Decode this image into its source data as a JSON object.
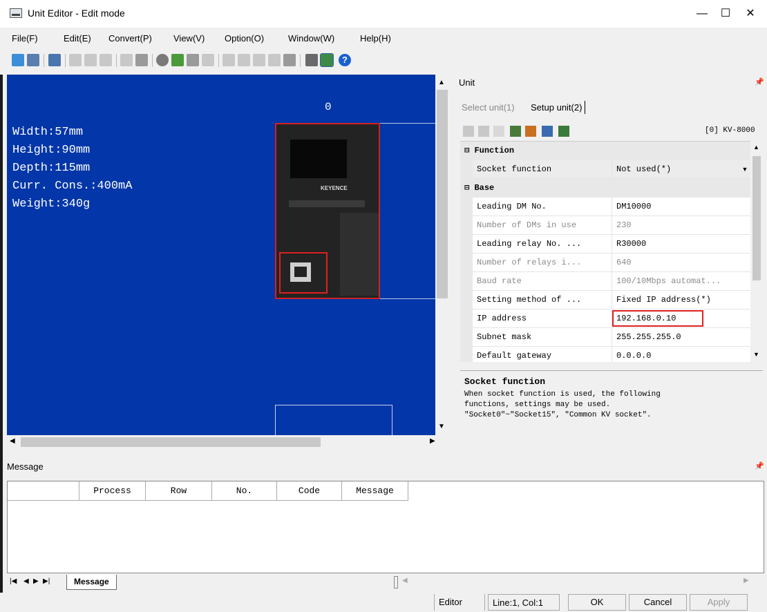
{
  "window": {
    "title": "Unit Editor - Edit mode",
    "minimize": "—",
    "maximize": "☐",
    "close": "✕"
  },
  "menu": [
    "File(F)",
    "Edit(E)",
    "Convert(P)",
    "View(V)",
    "Option(O)",
    "Window(W)",
    "Help(H)"
  ],
  "canvas": {
    "slot_number": "0",
    "specs": [
      "Width:57mm",
      "Height:90mm",
      "Depth:115mm",
      "Curr. Cons.:400mA",
      "Weight:340g"
    ],
    "brand": "KEYENCE",
    "background": "#0336a8"
  },
  "unit_panel": {
    "title": "Unit",
    "tabs": [
      "Select unit(1)",
      "Setup unit(2)"
    ],
    "unit_id": "[0] KV-8000",
    "categories": {
      "function": "Function",
      "base": "Base"
    },
    "function_rows": [
      {
        "name": "Socket function",
        "value": "Not used(*)"
      }
    ],
    "base_rows": [
      {
        "name": "Leading DM No.",
        "value": "DM10000",
        "grey": false
      },
      {
        "name": "Number of DMs in use",
        "value": "230",
        "grey": true
      },
      {
        "name": "Leading relay No. ...",
        "value": "R30000",
        "grey": false
      },
      {
        "name": "Number of relays i...",
        "value": "640",
        "grey": true
      },
      {
        "name": "Baud rate",
        "value": "100/10Mbps automat...",
        "grey": true
      },
      {
        "name": "Setting method of ...",
        "value": "Fixed IP address(*)",
        "grey": false
      },
      {
        "name": "IP address",
        "value": "192.168.0.10",
        "grey": false
      },
      {
        "name": "Subnet mask",
        "value": "255.255.255.0",
        "grey": false
      },
      {
        "name": "Default gateway",
        "value": "0.0.0.0",
        "grey": false
      }
    ],
    "description": {
      "title": "Socket function",
      "lines": [
        "When socket function is used, the following",
        "functions, settings may be used.",
        "\"Socket0\"~\"Socket15\", \"Common KV socket\"."
      ]
    }
  },
  "message_panel": {
    "title": "Message",
    "columns": [
      "Process",
      "Row",
      "No.",
      "Code",
      "Message"
    ],
    "tab": "Message"
  },
  "statusbar": {
    "mode": "Editor",
    "position": "Line:1, Col:1",
    "ok": "OK",
    "cancel": "Cancel",
    "apply": "Apply"
  },
  "colors": {
    "highlight": "#e02020",
    "help": "#1a5fd0"
  }
}
